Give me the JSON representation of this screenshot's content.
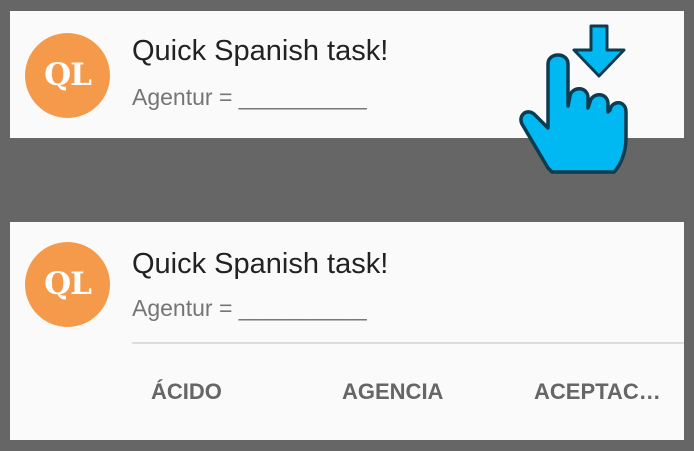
{
  "notifications": [
    {
      "app_icon_text": "QL",
      "title": "Quick Spanish task!",
      "body": "Agentur = __________"
    },
    {
      "app_icon_text": "QL",
      "title": "Quick Spanish task!",
      "body": "Agentur = __________",
      "actions": [
        "ÁCIDO",
        "AGENCIA",
        "ACEPTAC…"
      ]
    }
  ],
  "gesture_icon": "swipe-down-hand-icon",
  "colors": {
    "background": "#666666",
    "card": "#fafafa",
    "app_icon": "#f59a4a",
    "gesture_fill": "#00b9f2",
    "gesture_stroke": "#0d3b4f",
    "action_text": "#666666"
  }
}
